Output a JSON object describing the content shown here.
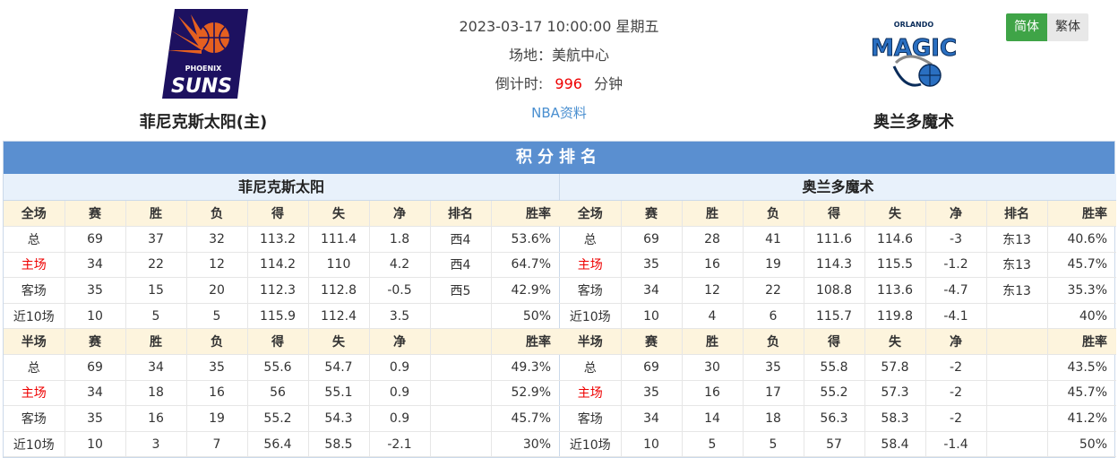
{
  "home_team": {
    "name": "菲尼克斯太阳(主)",
    "logo_text_top": "PHOENIX",
    "logo_text_main": "SUNS"
  },
  "away_team": {
    "name": "奥兰多魔术",
    "logo_text_top": "ORLANDO",
    "logo_text_main": "MAGIC"
  },
  "match": {
    "datetime": "2023-03-17 10:00:00 星期五",
    "venue": "场地：美航中心",
    "countdown_label": "倒计时:",
    "countdown_value": "996",
    "countdown_unit": "分钟",
    "nba_link": "NBA资料"
  },
  "lang": {
    "simplified": "简体",
    "traditional": "繁体"
  },
  "section_title": "积分排名",
  "colors": {
    "accent": "#5a8fd0",
    "lang_active": "#3fa447",
    "highlight_red": "#e00000",
    "header_row": "#fdf4dd"
  },
  "home": {
    "title": "菲尼克斯太阳",
    "full_header": [
      "全场",
      "赛",
      "胜",
      "负",
      "得",
      "失",
      "净",
      "排名",
      "胜率"
    ],
    "full_rows": [
      [
        "总",
        "69",
        "37",
        "32",
        "113.2",
        "111.4",
        "1.8",
        "西4",
        "53.6%"
      ],
      [
        "主场",
        "34",
        "22",
        "12",
        "114.2",
        "110",
        "4.2",
        "西4",
        "64.7%"
      ],
      [
        "客场",
        "35",
        "15",
        "20",
        "112.3",
        "112.8",
        "-0.5",
        "西5",
        "42.9%"
      ],
      [
        "近10场",
        "10",
        "5",
        "5",
        "115.9",
        "112.4",
        "3.5",
        "",
        "50%"
      ]
    ],
    "half_header": [
      "半场",
      "赛",
      "胜",
      "负",
      "得",
      "失",
      "净",
      "",
      "胜率"
    ],
    "half_rows": [
      [
        "总",
        "69",
        "34",
        "35",
        "55.6",
        "54.7",
        "0.9",
        "",
        "49.3%"
      ],
      [
        "主场",
        "34",
        "18",
        "16",
        "56",
        "55.1",
        "0.9",
        "",
        "52.9%"
      ],
      [
        "客场",
        "35",
        "16",
        "19",
        "55.2",
        "54.3",
        "0.9",
        "",
        "45.7%"
      ],
      [
        "近10场",
        "10",
        "3",
        "7",
        "56.4",
        "58.5",
        "-2.1",
        "",
        "30%"
      ]
    ]
  },
  "away": {
    "title": "奥兰多魔术",
    "full_header": [
      "全场",
      "赛",
      "胜",
      "负",
      "得",
      "失",
      "净",
      "排名",
      "胜率"
    ],
    "full_rows": [
      [
        "总",
        "69",
        "28",
        "41",
        "111.6",
        "114.6",
        "-3",
        "东13",
        "40.6%"
      ],
      [
        "主场",
        "35",
        "16",
        "19",
        "114.3",
        "115.5",
        "-1.2",
        "东13",
        "45.7%"
      ],
      [
        "客场",
        "34",
        "12",
        "22",
        "108.8",
        "113.6",
        "-4.7",
        "东13",
        "35.3%"
      ],
      [
        "近10场",
        "10",
        "4",
        "6",
        "115.7",
        "119.8",
        "-4.1",
        "",
        "40%"
      ]
    ],
    "half_header": [
      "半场",
      "赛",
      "胜",
      "负",
      "得",
      "失",
      "净",
      "",
      "胜率"
    ],
    "half_rows": [
      [
        "总",
        "69",
        "30",
        "35",
        "55.8",
        "57.8",
        "-2",
        "",
        "43.5%"
      ],
      [
        "主场",
        "35",
        "16",
        "17",
        "55.2",
        "57.3",
        "-2",
        "",
        "45.7%"
      ],
      [
        "客场",
        "34",
        "14",
        "18",
        "56.3",
        "58.3",
        "-2",
        "",
        "41.2%"
      ],
      [
        "近10场",
        "10",
        "5",
        "5",
        "57",
        "58.4",
        "-1.4",
        "",
        "50%"
      ]
    ]
  }
}
